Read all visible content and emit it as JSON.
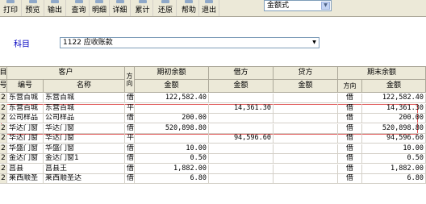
{
  "toolbar": {
    "buttons": [
      {
        "label": "打印",
        "icon": "printer-icon"
      },
      {
        "label": "预览",
        "icon": "preview-icon"
      },
      {
        "label": "输出",
        "icon": "export-icon"
      },
      {
        "label": "查询",
        "icon": "search-icon"
      },
      {
        "label": "明细",
        "icon": "detail-icon"
      },
      {
        "label": "详细",
        "icon": "list-icon"
      },
      {
        "label": "累计",
        "icon": "sum-icon"
      },
      {
        "label": "还原",
        "icon": "restore-icon"
      },
      {
        "label": "帮助",
        "icon": "help-icon"
      },
      {
        "label": "退出",
        "icon": "exit-icon"
      }
    ],
    "format_select": "金额式"
  },
  "subject": {
    "label": "科目",
    "value": "1122 应收账款"
  },
  "grid": {
    "headers": {
      "customer": "客户",
      "code": "编号",
      "name": "名称",
      "direction_top": "方向",
      "opening": "期初余额",
      "debit": "借方",
      "credit": "贷方",
      "closing": "期末余额",
      "amount": "金额",
      "direction": "方向"
    },
    "rows": [
      {
        "code": "东营百城",
        "name": "东营百城",
        "dir": "借",
        "opening": "122,582.40",
        "debit": "",
        "credit": "",
        "cdir": "借",
        "closing": "122,582.40"
      },
      {
        "code": "东营百城",
        "name": "东营百城",
        "dir": "平",
        "opening": "",
        "debit": "14,361.30",
        "credit": "",
        "cdir": "借",
        "closing": "14,361.30"
      },
      {
        "code": "公司样品",
        "name": "公司样品",
        "dir": "借",
        "opening": "200.00",
        "debit": "",
        "credit": "",
        "cdir": "借",
        "closing": "200.00"
      },
      {
        "code": "华达门窗",
        "name": "华达门窗",
        "dir": "借",
        "opening": "520,898.80",
        "debit": "",
        "credit": "",
        "cdir": "借",
        "closing": "520,898.80"
      },
      {
        "code": "华达门窗",
        "name": "华达门窗",
        "dir": "平",
        "opening": "",
        "debit": "94,596.60",
        "credit": "",
        "cdir": "借",
        "closing": "94,596.60"
      },
      {
        "code": "华盛门窗",
        "name": "华盛门窗",
        "dir": "借",
        "opening": "10.00",
        "debit": "",
        "credit": "",
        "cdir": "借",
        "closing": "10.00"
      },
      {
        "code": "金达门窗",
        "name": "金达门窗1",
        "dir": "借",
        "opening": "0.50",
        "debit": "",
        "credit": "",
        "cdir": "借",
        "closing": "0.50"
      },
      {
        "code": "莒县",
        "name": "莒县王",
        "dir": "借",
        "opening": "1,882.00",
        "debit": "",
        "credit": "",
        "cdir": "借",
        "closing": "1,882.00"
      },
      {
        "code": "莱西顺圣",
        "name": "莱西顺圣达",
        "dir": "借",
        "opening": "6.80",
        "debit": "",
        "credit": "",
        "cdir": "借",
        "closing": "6.80"
      }
    ],
    "left_col": [
      "目",
      "号",
      "2",
      "2",
      "2",
      "2",
      "2",
      "2",
      "2",
      "2",
      "2"
    ]
  }
}
